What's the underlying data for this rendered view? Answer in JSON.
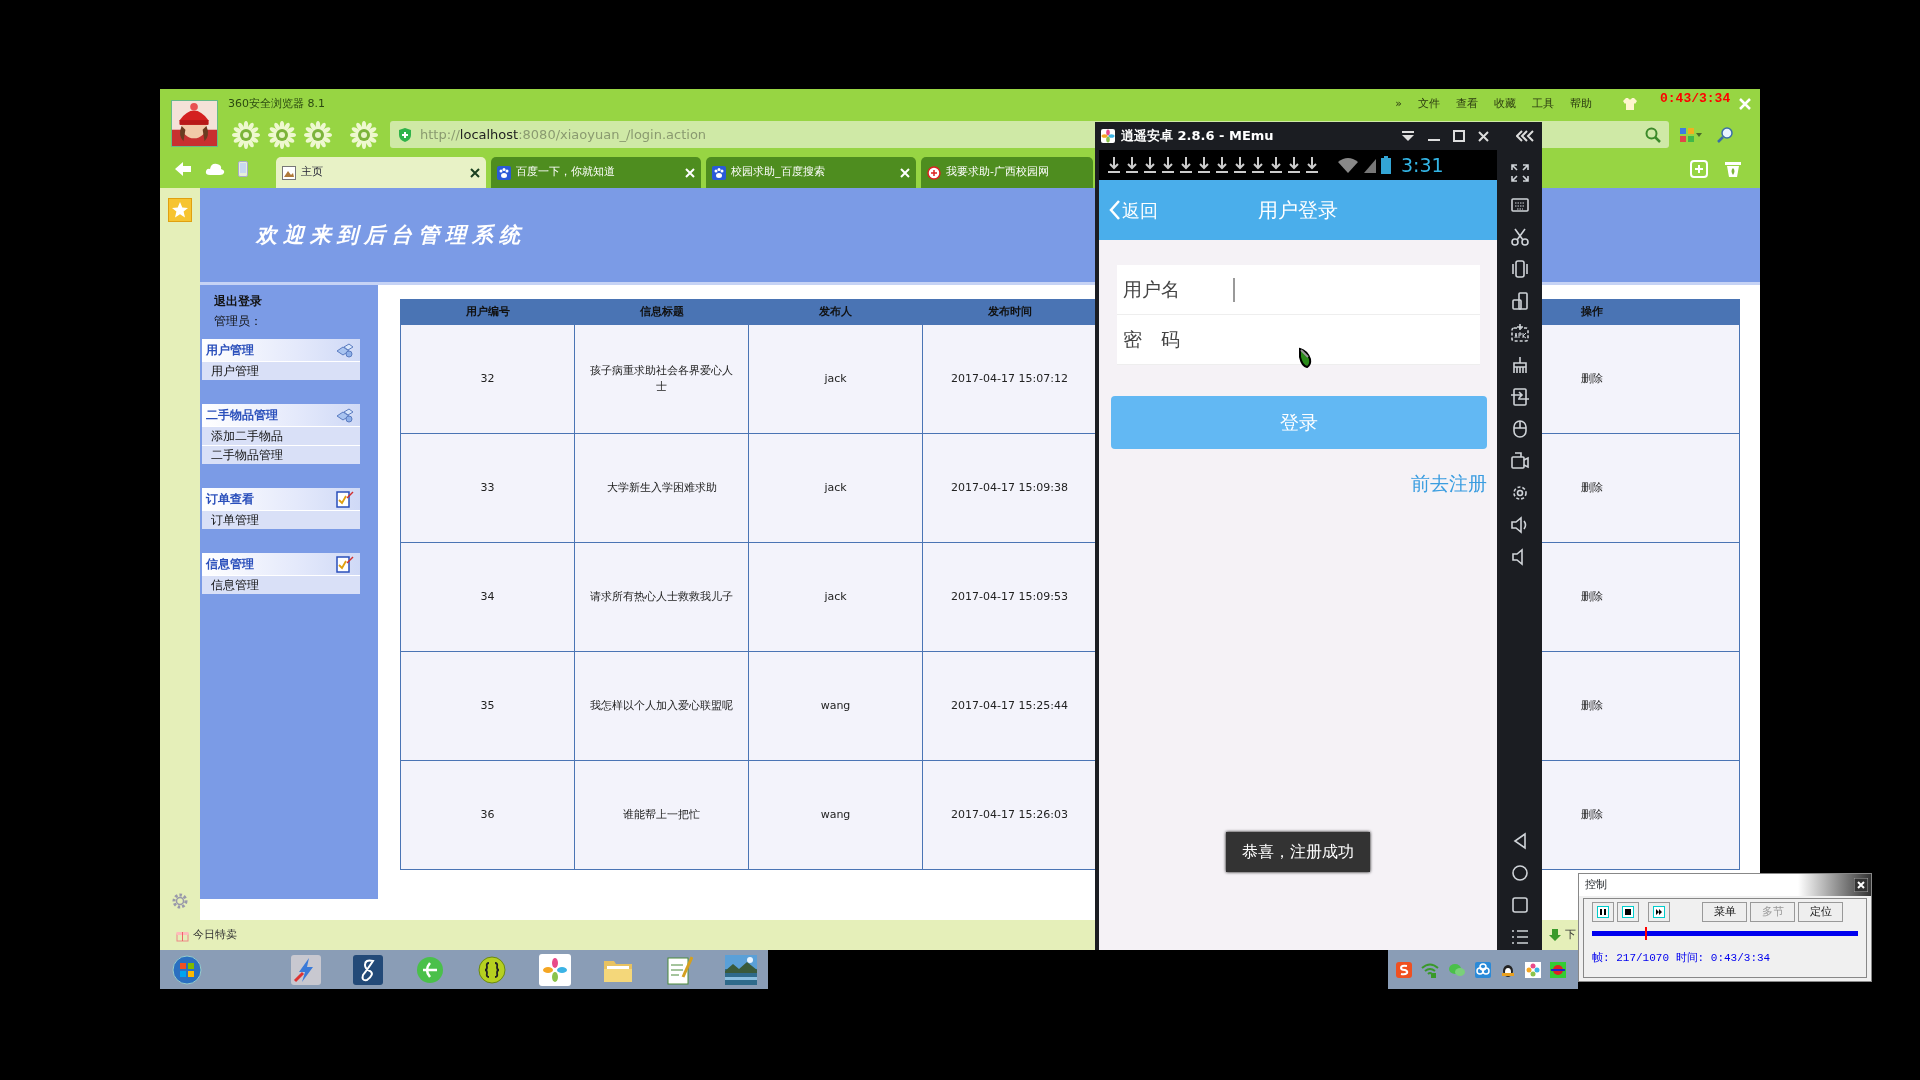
{
  "browser": {
    "title": "360安全浏览器 8.1",
    "menu": [
      "»",
      "文件",
      "查看",
      "收藏",
      "工具",
      "帮助"
    ],
    "address": {
      "scheme": "http://",
      "host": "localhost",
      "rest": ":8080/xiaoyuan_/login.action"
    },
    "tabs": [
      {
        "label": "主页",
        "selected": true
      },
      {
        "label": "百度一下，你就知道",
        "selected": false
      },
      {
        "label": "校园求助_百度搜索",
        "selected": false
      },
      {
        "label": "我要求助-广西校园网",
        "selected": false
      }
    ]
  },
  "page": {
    "header_title": "欢迎来到后台管理系统",
    "logout": "退出登录",
    "admin_label": "管理员：",
    "menu_groups": [
      {
        "title": "用户管理",
        "kind": "tools",
        "items": [
          "用户管理"
        ]
      },
      {
        "title": "二手物品管理",
        "kind": "tools",
        "items": [
          "添加二手物品",
          "二手物品管理"
        ]
      },
      {
        "title": "订单查看",
        "kind": "review",
        "items": [
          "订单管理"
        ]
      },
      {
        "title": "信息管理",
        "kind": "review",
        "items": [
          "信息管理"
        ]
      }
    ],
    "table": {
      "columns": [
        "用户编号",
        "信息标题",
        "发布人",
        "发布时间",
        "操作"
      ],
      "rows": [
        [
          "32",
          "孩子病重求助社会各界爱心人士",
          "jack",
          "2017-04-17 15:07:12",
          "删除"
        ],
        [
          "33",
          "大学新生入学困难求助",
          "jack",
          "2017-04-17 15:09:38",
          "删除"
        ],
        [
          "34",
          "请求所有热心人士救救我儿子",
          "jack",
          "2017-04-17 15:09:53",
          "删除"
        ],
        [
          "35",
          "我怎样以个人加入爱心联盟呢",
          "wang",
          "2017-04-17 15:25:44",
          "删除"
        ],
        [
          "36",
          "谁能帮上一把忙",
          "wang",
          "2017-04-17 15:26:03",
          "删除"
        ]
      ]
    }
  },
  "status_bar": {
    "left": "今日特卖",
    "right": "下"
  },
  "emulator": {
    "title": "逍遥安卓 2.8.6 - MEmu",
    "clock": "3:31",
    "back": "返回",
    "screen_title": "用户登录",
    "fields": [
      {
        "label": "用户名",
        "focused": true
      },
      {
        "label": "密　码",
        "focused": false
      }
    ],
    "login_button": "登录",
    "register_link": "前去注册",
    "toast": "恭喜，注册成功"
  },
  "recorder": {
    "time_overlay": "0:43/3:34",
    "title": "控制",
    "buttons": [
      {
        "label": "菜单",
        "disabled": false
      },
      {
        "label": "多节",
        "disabled": true
      },
      {
        "label": "定位",
        "disabled": false
      }
    ],
    "level": 0.203,
    "readout": "帧: 217/1070 时间: 0:43/3:34"
  }
}
